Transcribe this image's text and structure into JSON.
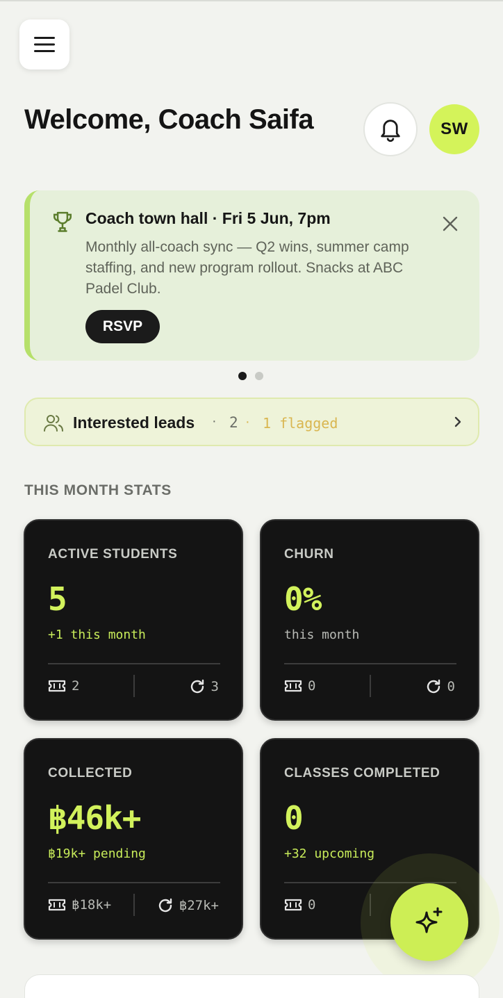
{
  "header": {
    "greeting": "Welcome, Coach Saifa",
    "avatar_initials": "SW"
  },
  "banner": {
    "title": "Coach town hall · Fri 5 Jun, 7pm",
    "body": "Monthly all-coach sync — Q2 wins, summer camp staffing, and new program rollout. Snacks at ABC Padel Club.",
    "rsvp_label": "RSVP",
    "page_count": 2,
    "active_page": 1
  },
  "leads": {
    "label": "Interested leads",
    "sep": "·",
    "count": "2",
    "flagged": "1 flagged"
  },
  "stats": {
    "section_title": "THIS MONTH STATS",
    "cards": [
      {
        "label": "ACTIVE STUDENTS",
        "value": "5",
        "sub": "+1 this month",
        "left": "2",
        "right": "3"
      },
      {
        "label": "CHURN",
        "value": "0%",
        "sub": "this month",
        "left": "0",
        "right": "0"
      },
      {
        "label": "COLLECTED",
        "value": "฿46k+",
        "sub": "฿19k+ pending",
        "left": "฿18k+",
        "right": "฿27k+"
      },
      {
        "label": "CLASSES COMPLETED",
        "value": "0",
        "sub": "+32 upcoming",
        "left": "0",
        "right": ""
      }
    ]
  },
  "icons": {
    "menu": "menu-icon",
    "bell": "bell-icon",
    "trophy": "trophy-icon",
    "close": "close-icon",
    "users": "users-icon",
    "chevron": "chevron-right-icon",
    "ticket": "ticket-icon",
    "refresh": "refresh-icon",
    "sparkle": "sparkle-icon"
  },
  "colors": {
    "accent": "#d4f35a",
    "banner_bg": "#e6f0da",
    "card_bg": "#141414",
    "flag": "#d9b650"
  }
}
